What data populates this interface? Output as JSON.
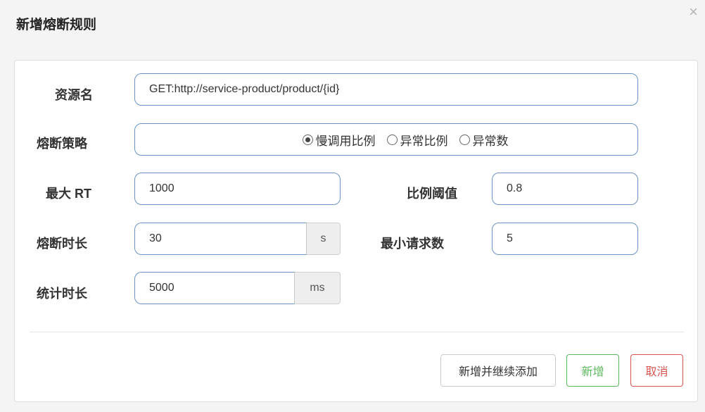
{
  "dialog": {
    "title": "新增熔断规则",
    "close_glyph": "×"
  },
  "form": {
    "resource": {
      "label": "资源名",
      "value": "GET:http://service-product/product/{id}"
    },
    "strategy": {
      "label": "熔断策略",
      "options": [
        {
          "label": "慢调用比例",
          "checked": true
        },
        {
          "label": "异常比例",
          "checked": false
        },
        {
          "label": "异常数",
          "checked": false
        }
      ]
    },
    "max_rt": {
      "label": "最大 RT",
      "value": "1000"
    },
    "ratio_threshold": {
      "label": "比例阈值",
      "value": "0.8"
    },
    "break_duration": {
      "label": "熔断时长",
      "value": "30",
      "unit": "s"
    },
    "min_requests": {
      "label": "最小请求数",
      "value": "5"
    },
    "stat_duration": {
      "label": "统计时长",
      "value": "5000",
      "unit": "ms"
    }
  },
  "buttons": {
    "add_continue": "新增并继续添加",
    "add": "新增",
    "cancel": "取消"
  },
  "colors": {
    "input_border": "#6b93c7",
    "success": "#5cb85c",
    "danger": "#d9534f"
  }
}
